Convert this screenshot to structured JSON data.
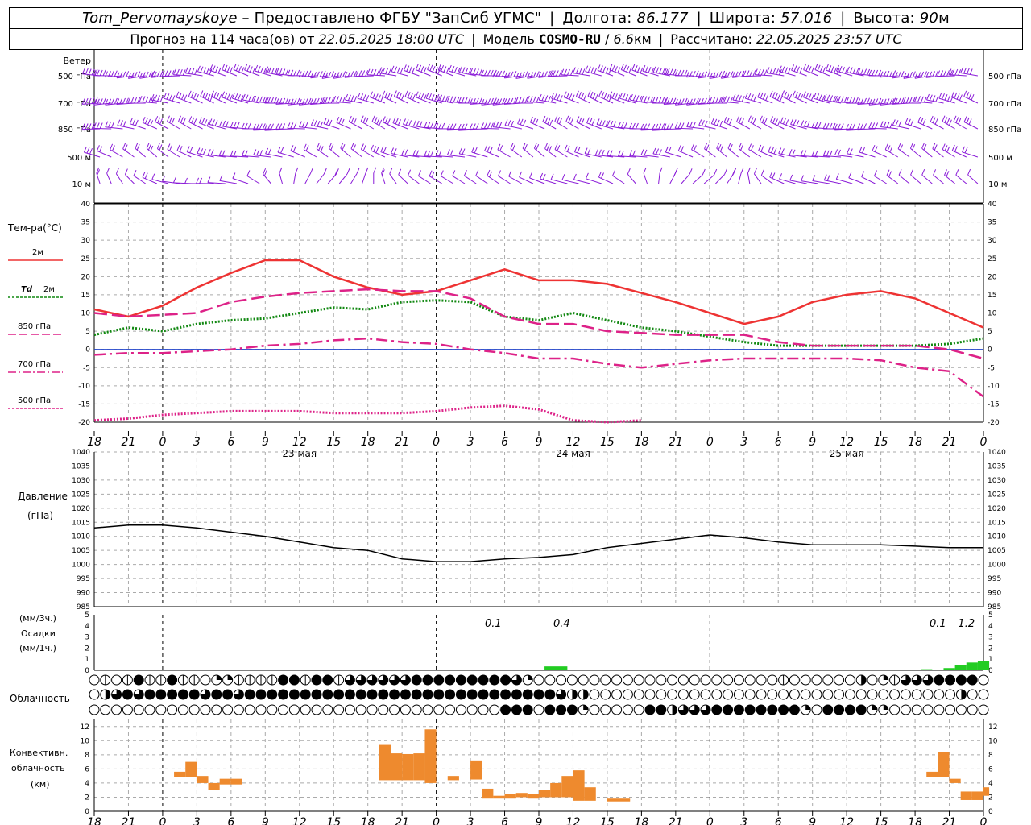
{
  "header": {
    "station": "Tom_Pervomayskoye",
    "provided_by": "– Предоставлено ФГБУ \"ЗапСиб УГМС\"",
    "lon_label": "Долгота:",
    "lon": "86.177",
    "lat_label": "Широта:",
    "lat": "57.016",
    "alt_label": "Высота:",
    "alt": "90",
    "alt_unit": "м",
    "forecast_prefix": "Прогноз на 114 часа(ов) от",
    "forecast_start": "22.05.2025 18:00 UTC",
    "model_label": "Модель",
    "model": "COSMO-RU",
    "resolution": "6.6",
    "resolution_unit": "км",
    "calc_label": "Рассчитано:",
    "calc_time": "22.05.2025 23:57 UTC"
  },
  "chart_data": [
    {
      "type": "wind_barbs",
      "title": "Ветер",
      "levels": [
        "500 гПа",
        "700 гПа",
        "850 гПа",
        "500 м",
        "10  м"
      ],
      "color": "#8a1bd8"
    },
    {
      "type": "line",
      "ylabel": "Тем-ра(°С)",
      "ylim": [
        -20,
        40
      ],
      "yticks": [
        -20,
        -15,
        -10,
        -5,
        0,
        5,
        10,
        15,
        20,
        25,
        30,
        35,
        40
      ],
      "x_hours": [
        0,
        3,
        6,
        9,
        12,
        15,
        18,
        21,
        24,
        27,
        30,
        33,
        36,
        39,
        42,
        45,
        48,
        51,
        54,
        57,
        60,
        63,
        66,
        69,
        72,
        75,
        78
      ],
      "series": [
        {
          "name": "2м",
          "color": "#ee3333",
          "dash": "solid",
          "values": [
            11,
            9,
            12,
            17,
            21,
            24.5,
            24.5,
            20,
            17,
            15,
            16,
            19,
            22,
            19,
            19,
            18,
            15.5,
            13,
            10,
            7,
            9,
            13,
            15,
            16,
            14,
            10,
            6
          ]
        },
        {
          "name": "Td 2м",
          "color": "#118811",
          "dash": "dotted",
          "values": [
            4,
            6,
            5,
            7,
            8,
            8.5,
            10,
            11.5,
            11,
            13,
            13.5,
            13,
            9,
            8,
            10,
            8,
            6,
            5,
            3.5,
            2,
            1,
            1,
            1,
            1,
            1,
            1.5,
            3
          ]
        },
        {
          "name": "850 гПа",
          "color": "#dd2288",
          "dash": "longdash",
          "values": [
            10,
            9,
            9.5,
            10,
            13,
            14.5,
            15.5,
            16,
            16.5,
            16,
            16,
            14,
            9,
            7,
            7,
            5,
            4.5,
            4,
            4,
            4,
            2,
            1,
            1,
            1,
            1,
            0,
            -2.5
          ]
        },
        {
          "name": "700 гПа",
          "color": "#dd2288",
          "dash": "dashdot",
          "values": [
            -1.5,
            -1,
            -1,
            -0.5,
            0,
            1,
            1.5,
            2.5,
            3,
            2,
            1.5,
            0,
            -1,
            -2.5,
            -2.5,
            -4,
            -5,
            -4,
            -3,
            -2.5,
            -2.5,
            -2.5,
            -2.5,
            -3,
            -5,
            -6,
            -13
          ]
        },
        {
          "name": "500 гПа",
          "color": "#dd2288",
          "dash": "dotted",
          "values": [
            -19.5,
            -19,
            -18,
            -17.5,
            -17,
            -17,
            -17,
            -17.5,
            -17.5,
            -17.5,
            -17,
            -16,
            -15.5,
            -16.5,
            -19.5,
            -20,
            -19.5
          ]
        }
      ]
    },
    {
      "type": "line",
      "ylabel": "Давление (гПа)",
      "ylim": [
        985,
        1040
      ],
      "yticks": [
        985,
        990,
        995,
        1000,
        1005,
        1010,
        1015,
        1020,
        1025,
        1030,
        1035,
        1040
      ],
      "x_hours": [
        0,
        3,
        6,
        9,
        12,
        15,
        18,
        21,
        24,
        27,
        30,
        33,
        36,
        39,
        42,
        45,
        48,
        51,
        54,
        57,
        60,
        63,
        66,
        69,
        72,
        75,
        78
      ],
      "series": [
        {
          "name": "Давление",
          "color": "#000000",
          "values": [
            1013,
            1014,
            1014,
            1013,
            1011.5,
            1010,
            1008,
            1006,
            1005,
            1002,
            1001,
            1001,
            1002,
            1002.5,
            1003.5,
            1006,
            1007.5,
            1009,
            1010.5,
            1009.5,
            1008,
            1007,
            1007,
            1007,
            1006.5,
            1006,
            1006
          ]
        }
      ]
    },
    {
      "type": "bar",
      "ylabel": "(мм/3ч.) Осадки (мм/1ч.)",
      "ylim": [
        0,
        5
      ],
      "yticks": [
        0,
        1,
        2,
        3,
        4,
        5
      ],
      "bars": [
        {
          "start": 35.5,
          "end": 36.5,
          "value": 0.05
        },
        {
          "start": 39.5,
          "end": 41.5,
          "value": 0.35
        },
        {
          "start": 72.5,
          "end": 73.5,
          "value": 0.1
        },
        {
          "start": 74.5,
          "end": 75.5,
          "value": 0.2
        },
        {
          "start": 75.5,
          "end": 76.5,
          "value": 0.5
        },
        {
          "start": 76.5,
          "end": 77.5,
          "value": 0.7
        },
        {
          "start": 77.5,
          "end": 78.5,
          "value": 0.8
        }
      ],
      "annotations": [
        {
          "hour": 35,
          "text": "0.1"
        },
        {
          "hour": 41,
          "text": "0.4"
        },
        {
          "hour": 74,
          "text": "0.1"
        },
        {
          "hour": 76.5,
          "text": "1.2"
        }
      ],
      "color": "#22cc22"
    },
    {
      "type": "heatmap",
      "title": "Облачность",
      "levels": [
        "upper",
        "middle",
        "lower"
      ],
      "codes_legend": "0=ясно,1=1/4,2=1/2 верт.,3=1/2,4=3/4,5=сплошная",
      "rows": [
        "020252252201122225525524444445555555554100000000000000000000002000000301244455550",
        "034545555545545555555555555555555555555555433000000000000000000000000000000000300",
        "000000000000000000000000000000000000055505551000005534445555555510555511000000000"
      ]
    },
    {
      "type": "bar",
      "ylabel": "Конвективн. облачность (км)",
      "ylim": [
        0,
        13
      ],
      "yticks": [
        0,
        2,
        4,
        6,
        8,
        10,
        12
      ],
      "bars": [
        {
          "start": 7,
          "end": 8,
          "base": 4.8,
          "top": 5.6
        },
        {
          "start": 8,
          "end": 9,
          "base": 4.8,
          "top": 7
        },
        {
          "start": 9,
          "end": 10,
          "base": 4,
          "top": 5
        },
        {
          "start": 10,
          "end": 11,
          "base": 3,
          "top": 4
        },
        {
          "start": 11,
          "end": 12,
          "base": 3.8,
          "top": 4.6
        },
        {
          "start": 12,
          "end": 13,
          "base": 3.8,
          "top": 4.6
        },
        {
          "start": 25,
          "end": 26,
          "base": 4.4,
          "top": 9.4
        },
        {
          "start": 26,
          "end": 27,
          "base": 4.4,
          "top": 8.2
        },
        {
          "start": 27,
          "end": 28,
          "base": 4.4,
          "top": 8.1
        },
        {
          "start": 28,
          "end": 29,
          "base": 4.4,
          "top": 8.2
        },
        {
          "start": 29,
          "end": 30,
          "base": 4,
          "top": 11.6
        },
        {
          "start": 31,
          "end": 32,
          "base": 4.4,
          "top": 5
        },
        {
          "start": 33,
          "end": 34,
          "base": 4.5,
          "top": 7.2
        },
        {
          "start": 34,
          "end": 35,
          "base": 1.8,
          "top": 3.2
        },
        {
          "start": 35,
          "end": 36,
          "base": 1.8,
          "top": 2.2
        },
        {
          "start": 36,
          "end": 37,
          "base": 1.8,
          "top": 2.4
        },
        {
          "start": 37,
          "end": 38,
          "base": 2,
          "top": 2.6
        },
        {
          "start": 38,
          "end": 39,
          "base": 1.8,
          "top": 2.4
        },
        {
          "start": 39,
          "end": 40,
          "base": 2,
          "top": 3
        },
        {
          "start": 40,
          "end": 41,
          "base": 2,
          "top": 4
        },
        {
          "start": 41,
          "end": 42,
          "base": 2,
          "top": 5
        },
        {
          "start": 42,
          "end": 43,
          "base": 1.5,
          "top": 5.8
        },
        {
          "start": 43,
          "end": 44,
          "base": 1.5,
          "top": 3.4
        },
        {
          "start": 45,
          "end": 46,
          "base": 1.4,
          "top": 1.8
        },
        {
          "start": 46,
          "end": 47,
          "base": 1.4,
          "top": 1.8
        },
        {
          "start": 73,
          "end": 74,
          "base": 4.8,
          "top": 5.6
        },
        {
          "start": 74,
          "end": 75,
          "base": 4.8,
          "top": 8.4
        },
        {
          "start": 75,
          "end": 76,
          "base": 4,
          "top": 4.6
        },
        {
          "start": 76,
          "end": 77,
          "base": 1.6,
          "top": 2.8
        },
        {
          "start": 77,
          "end": 78,
          "base": 1.6,
          "top": 2.8
        },
        {
          "start": 78,
          "end": 78.5,
          "base": 2.2,
          "top": 3.4
        }
      ],
      "color": "#ee8a2e"
    }
  ],
  "x_axis": {
    "tick_labels": [
      "18",
      "21",
      "0",
      "3",
      "6",
      "9",
      "12",
      "15",
      "18",
      "21",
      "0",
      "3",
      "6",
      "9",
      "12",
      "15",
      "18",
      "21",
      "0",
      "3",
      "6",
      "9",
      "12",
      "15",
      "18",
      "21",
      "0"
    ],
    "day_labels": [
      "23 мая",
      "24 мая",
      "25 мая"
    ]
  },
  "panel_labels": {
    "wind": "Ветер",
    "temp": "Тем-ра(°С)",
    "legend_2m": "2м",
    "legend_td": "Td",
    "legend_td_suffix": "2м",
    "legend_850": "850 гПа",
    "legend_700": "700 гПа",
    "legend_500": "500 гПа",
    "pressure_1": "Давление",
    "pressure_2": "(гПа)",
    "precip_1": "(мм/3ч.)",
    "precip_2": "Осадки",
    "precip_3": "(мм/1ч.)",
    "cloud": "Облачность",
    "conv_1": "Конвективн.",
    "conv_2": "облачность",
    "conv_3": "(км)"
  },
  "colors": {
    "wind": "#8a1bd8",
    "temp": "#ee3333",
    "dew": "#118811",
    "upper": "#dd2288",
    "zero_line": "#2244cc",
    "precip": "#22cc22",
    "convective": "#ee8a2e",
    "grid": "#aaaaaa"
  }
}
